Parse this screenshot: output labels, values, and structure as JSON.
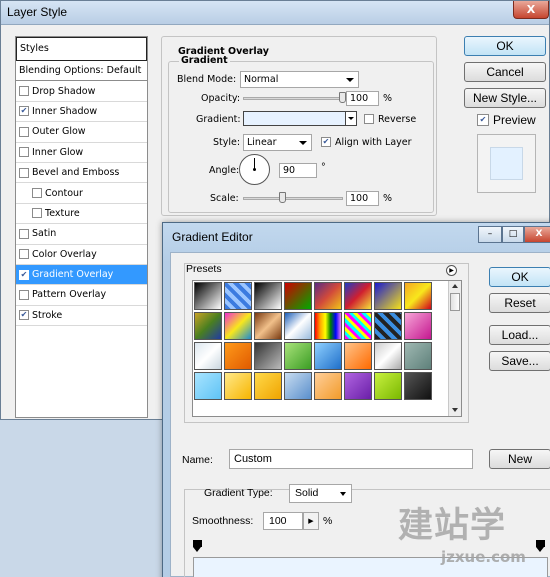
{
  "layer_style": {
    "title": "Layer Style",
    "close_glyph": "X",
    "styles_header": "Styles",
    "items": [
      {
        "label": "Blending Options: Default",
        "checkbox": false,
        "checked": false,
        "sub": false,
        "selected": false
      },
      {
        "label": "Drop Shadow",
        "checkbox": true,
        "checked": false,
        "sub": false,
        "selected": false
      },
      {
        "label": "Inner Shadow",
        "checkbox": true,
        "checked": true,
        "sub": false,
        "selected": false
      },
      {
        "label": "Outer Glow",
        "checkbox": true,
        "checked": false,
        "sub": false,
        "selected": false
      },
      {
        "label": "Inner Glow",
        "checkbox": true,
        "checked": false,
        "sub": false,
        "selected": false
      },
      {
        "label": "Bevel and Emboss",
        "checkbox": true,
        "checked": false,
        "sub": false,
        "selected": false
      },
      {
        "label": "Contour",
        "checkbox": true,
        "checked": false,
        "sub": true,
        "selected": false
      },
      {
        "label": "Texture",
        "checkbox": true,
        "checked": false,
        "sub": true,
        "selected": false
      },
      {
        "label": "Satin",
        "checkbox": true,
        "checked": false,
        "sub": false,
        "selected": false
      },
      {
        "label": "Color Overlay",
        "checkbox": true,
        "checked": false,
        "sub": false,
        "selected": false
      },
      {
        "label": "Gradient Overlay",
        "checkbox": true,
        "checked": true,
        "sub": false,
        "selected": true
      },
      {
        "label": "Pattern Overlay",
        "checkbox": true,
        "checked": false,
        "sub": false,
        "selected": false
      },
      {
        "label": "Stroke",
        "checkbox": true,
        "checked": true,
        "sub": false,
        "selected": false
      }
    ],
    "gradient_overlay": {
      "title": "Gradient Overlay",
      "subtitle": "Gradient",
      "blend_mode_label": "Blend Mode:",
      "blend_mode_value": "Normal",
      "opacity_label": "Opacity:",
      "opacity_value": "100",
      "opacity_unit": "%",
      "opacity_fraction": 1.0,
      "gradient_label": "Gradient:",
      "reverse_label": "Reverse",
      "reverse_checked": false,
      "style_label": "Style:",
      "style_value": "Linear",
      "align_label": "Align with Layer",
      "align_checked": true,
      "angle_label": "Angle:",
      "angle_value": "90",
      "angle_unit": "°",
      "scale_label": "Scale:",
      "scale_value": "100",
      "scale_unit": "%",
      "scale_fraction": 0.4
    },
    "buttons": {
      "ok": "OK",
      "cancel": "Cancel",
      "new_style": "New Style...",
      "preview": "Preview"
    },
    "preview_checked": true
  },
  "gradient_editor": {
    "title": "Gradient Editor",
    "window_controls": [
      "–",
      "□",
      "X"
    ],
    "presets_label": "Presets",
    "presets_menu_glyph": "▶",
    "buttons": {
      "ok": "OK",
      "reset": "Reset",
      "load": "Load...",
      "save": "Save...",
      "new": "New"
    },
    "name_label": "Name:",
    "name_value": "Custom",
    "gradient_type_label": "Gradient Type:",
    "gradient_type_value": "Solid",
    "smoothness_label": "Smoothness:",
    "smoothness_value": "100",
    "smoothness_unit": "%",
    "smoothness_arrow": "▶",
    "stop_color_label": "#f2faff",
    "presets": [
      "linear-gradient(135deg,#000,#fff)",
      "repeating-linear-gradient(45deg,#3b7be0 0 4px,#9cc6ff 4px 8px)",
      "linear-gradient(135deg,#000,#fff)",
      "linear-gradient(135deg,#c00,#0a0)",
      "linear-gradient(135deg,#5a2d82,#d24a3a,#f0c419)",
      "linear-gradient(135deg,#1f3cc4,#d01f2f,#f4e33a)",
      "linear-gradient(135deg,#1a1ad0,#f5e11a)",
      "linear-gradient(135deg,#f5a623,#f8e71c,#d0021b)",
      "linear-gradient(135deg,#c9a227,#4a7f20,#203aa3)",
      "linear-gradient(135deg,#f12fcf,#f8e71c,#1e8bd0)",
      "linear-gradient(135deg,#7a3b12,#f1c08a,#7a3b12)",
      "linear-gradient(135deg,#1d5fb8,#fff,#9bd)",
      "linear-gradient(90deg,red,orange,yellow,green,blue,violet)",
      "repeating-linear-gradient(45deg,#f0f 0 3px,#0ff 3px 6px,#ff0 6px 9px)",
      "repeating-linear-gradient(45deg,#222 0 4px,#3b8ee0 4px 8px)",
      "linear-gradient(135deg,#f7a6d8,#c4178f)",
      "linear-gradient(135deg,#dce6ee,#fff,#c9d6df)",
      "linear-gradient(135deg,#ff9a1a,#e05a00)",
      "linear-gradient(135deg,#333,#bbb)",
      "linear-gradient(135deg,#a9e27a,#3b9d24)",
      "linear-gradient(135deg,#8fd0ff,#1f6fc9)",
      "linear-gradient(135deg,#ffc48a,#ff6a00)",
      "linear-gradient(135deg,#ccc,#fff,#aaa)",
      "linear-gradient(135deg,#9fb8b2,#5e807a)",
      "linear-gradient(135deg,#a8e4ff,#5fc3f5)",
      "linear-gradient(135deg,#ffe98a,#f7b500)",
      "linear-gradient(135deg,#ffd94a,#f0a400)",
      "linear-gradient(135deg,#c8dcf0,#5a8fcc)",
      "linear-gradient(135deg,#ffcf9a,#f29b2a)",
      "linear-gradient(135deg,#b064e0,#6a1fa8)",
      "linear-gradient(135deg,#c8f040,#7ab800)",
      "linear-gradient(135deg,#555,#111)"
    ]
  },
  "watermark": {
    "main": "建站学",
    "sub": "jzxue.com"
  },
  "colors": {
    "selection": "#3399ff",
    "gradient_stop": "#f2faff",
    "gradient_swatch": "#e7f2ff"
  }
}
